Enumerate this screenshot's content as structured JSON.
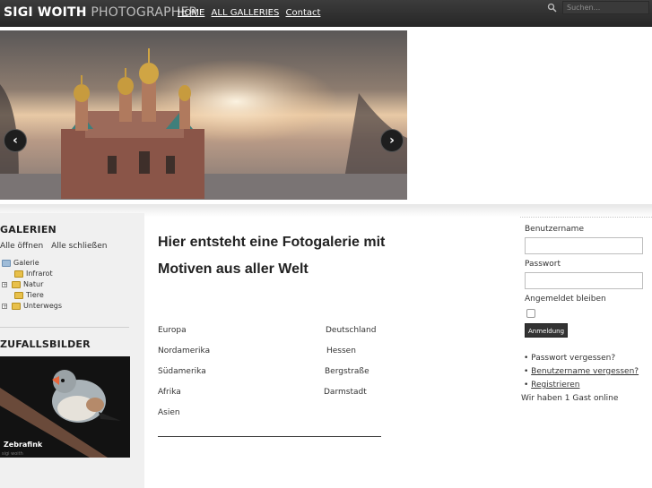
{
  "header": {
    "logo_bold": "SIGI WOITH",
    "logo_light": "PHOTOGRAPHER",
    "nav": [
      "HOME",
      "ALL GALLERIES",
      "Contact"
    ],
    "search_placeholder": "Suchen...",
    "search_icon": "search-icon"
  },
  "slider": {
    "prev_icon": "chevron-left-icon",
    "next_icon": "chevron-right-icon",
    "prev_glyph": "‹",
    "next_glyph": "›"
  },
  "sidebar": {
    "galleries_title": "GALERIEN",
    "open_all": "Alle öffnen",
    "close_all": "Alle schließen",
    "tree_root": "Galerie",
    "tree_items": [
      "Infrarot",
      "Natur",
      "Tiere",
      "Unterwegs"
    ],
    "random_title": "ZUFALLSBILDER",
    "random_caption": "Zebrafink",
    "random_credit": "sigi woith"
  },
  "main": {
    "headline_line1": "Hier entsteht eine Fotogalerie mit",
    "headline_line2": "Motiven aus aller Welt",
    "regions_left": [
      "Europa",
      "Nordamerika",
      "Südamerika",
      "Afrika",
      "Asien"
    ],
    "regions_right": [
      "Deutschland",
      "Hessen",
      "Bergstraße",
      "Darmstadt"
    ]
  },
  "login": {
    "username_label": "Benutzername",
    "password_label": "Passwort",
    "remember_label": "Angemeldet bleiben",
    "submit": "Anmeldung",
    "forgot_password": "Passwort vergessen?",
    "forgot_username": "Benutzername vergessen?",
    "register": "Registrieren",
    "online": "Wir haben 1 Gast online"
  }
}
